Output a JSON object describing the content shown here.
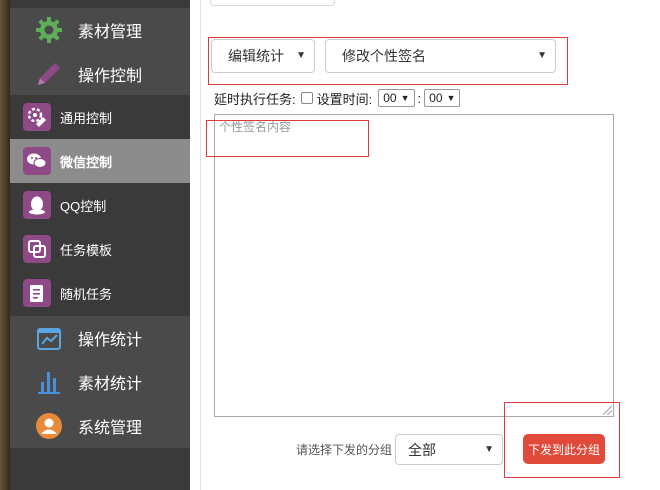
{
  "sidebar": {
    "top_items": [
      {
        "label": "素材管理",
        "icon": "gear-icon",
        "color": "#5fae5a"
      },
      {
        "label": "操作控制",
        "icon": "pencil-icon",
        "color": "#8e4a86"
      }
    ],
    "sub_items": [
      {
        "label": "通用控制",
        "icon": "gear-edit-icon"
      },
      {
        "label": "微信控制",
        "icon": "wechat-icon",
        "active": true
      },
      {
        "label": "QQ控制",
        "icon": "qq-icon"
      },
      {
        "label": "任务模板",
        "icon": "template-icon"
      },
      {
        "label": "随机任务",
        "icon": "clipboard-icon"
      }
    ],
    "bottom_items": [
      {
        "label": "操作统计",
        "icon": "chart-line-icon",
        "color": "#5aa6e0"
      },
      {
        "label": "素材统计",
        "icon": "bar-chart-icon",
        "color": "#4a90d9"
      },
      {
        "label": "系统管理",
        "icon": "user-icon",
        "color": "#e88a3a"
      }
    ]
  },
  "main": {
    "category_select": {
      "value": "编辑统计"
    },
    "action_select": {
      "value": "修改个性签名"
    },
    "delay": {
      "label": "延时执行任务:",
      "set_time_label": "设置时间:",
      "hour": "00",
      "separator": ":",
      "minute": "00"
    },
    "textarea": {
      "placeholder": "个性签名内容"
    },
    "group": {
      "label": "请选择下发的分组",
      "value": "全部"
    },
    "send_button": "下发到此分组"
  },
  "colors": {
    "highlight": "#e03a3a",
    "send_button": "#e04a3a",
    "sidebar_bg": "#3a3a3a",
    "submenu_icon_bg": "#8e4a86"
  }
}
